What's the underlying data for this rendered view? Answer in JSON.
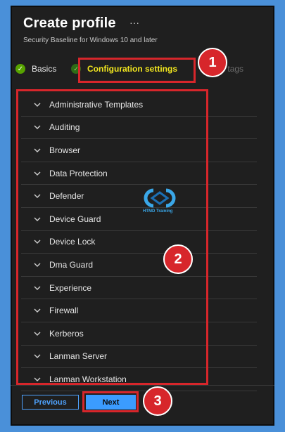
{
  "header": {
    "title": "Create profile",
    "more_label": "···",
    "subtitle": "Security Baseline for Windows 10 and later"
  },
  "tabs": [
    {
      "label": "Basics",
      "state": "complete"
    },
    {
      "label": "Configuration settings",
      "state": "current"
    },
    {
      "label": "ope tags",
      "state": "upcoming"
    }
  ],
  "settings": [
    {
      "label": "Administrative Templates"
    },
    {
      "label": "Auditing"
    },
    {
      "label": "Browser"
    },
    {
      "label": "Data Protection"
    },
    {
      "label": "Defender"
    },
    {
      "label": "Device Guard"
    },
    {
      "label": "Device Lock"
    },
    {
      "label": "Dma Guard"
    },
    {
      "label": "Experience"
    },
    {
      "label": "Firewall"
    },
    {
      "label": "Kerberos"
    },
    {
      "label": "Lanman Server"
    },
    {
      "label": "Lanman Workstation"
    }
  ],
  "footer": {
    "previous_label": "Previous",
    "next_label": "Next"
  },
  "callouts": [
    "1",
    "2",
    "3"
  ],
  "watermark": {
    "caption": "HTMD Training"
  },
  "icons": {
    "basics_status": "checkmark-icon",
    "config_status": "checkmark-icon",
    "row_expander": "chevron-down-icon"
  },
  "colors": {
    "panel_bg": "#1f1f1f",
    "page_bg": "#4a90d9",
    "accent_yellow": "#f2e71f",
    "success_green": "#57a300",
    "callout_red": "#d7262b",
    "primary_blue": "#3b9cff"
  }
}
